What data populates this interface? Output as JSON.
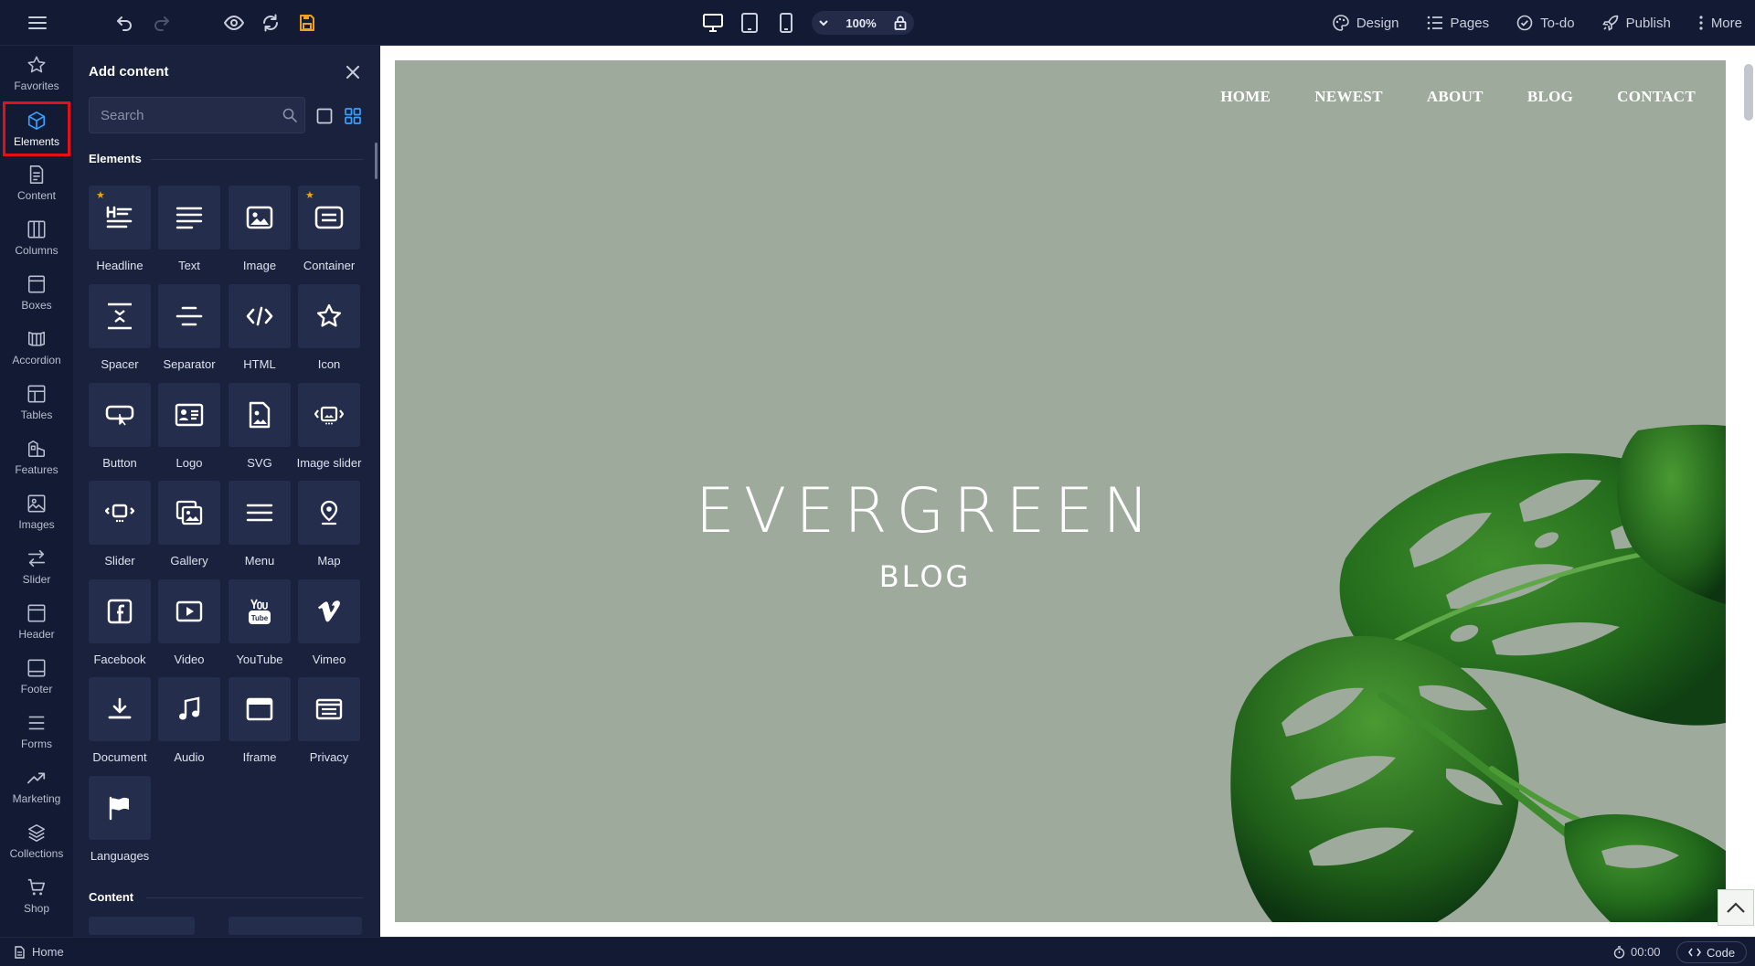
{
  "toolbar": {
    "zoom": "100%",
    "links": [
      {
        "label": "Design",
        "icon": "palette-icon"
      },
      {
        "label": "Pages",
        "icon": "list-icon"
      },
      {
        "label": "To-do",
        "icon": "check-circle-icon"
      },
      {
        "label": "Publish",
        "icon": "rocket-icon"
      },
      {
        "label": "More",
        "icon": "kebab-icon"
      }
    ]
  },
  "rail": {
    "active": "Elements",
    "items": [
      {
        "label": "Favorites",
        "icon": "star-icon"
      },
      {
        "label": "Elements",
        "icon": "cube-icon"
      },
      {
        "label": "Content",
        "icon": "document-icon"
      },
      {
        "label": "Columns",
        "icon": "columns-icon"
      },
      {
        "label": "Boxes",
        "icon": "box-icon"
      },
      {
        "label": "Accordion",
        "icon": "accordion-icon"
      },
      {
        "label": "Tables",
        "icon": "table-icon"
      },
      {
        "label": "Features",
        "icon": "features-icon"
      },
      {
        "label": "Images",
        "icon": "image-icon"
      },
      {
        "label": "Slider",
        "icon": "slider-icon"
      },
      {
        "label": "Header",
        "icon": "header-icon"
      },
      {
        "label": "Footer",
        "icon": "footer-icon"
      },
      {
        "label": "Forms",
        "icon": "forms-icon"
      },
      {
        "label": "Marketing",
        "icon": "trend-icon"
      },
      {
        "label": "Collections",
        "icon": "layers-icon"
      },
      {
        "label": "Shop",
        "icon": "cart-icon"
      }
    ]
  },
  "panel": {
    "title": "Add content",
    "search_placeholder": "Search",
    "sections": {
      "elements": "Elements",
      "content": "Content"
    },
    "elements": [
      {
        "label": "Headline",
        "icon": "headline-icon",
        "favorite": true
      },
      {
        "label": "Text",
        "icon": "text-icon",
        "favorite": false
      },
      {
        "label": "Image",
        "icon": "image-icon",
        "favorite": false
      },
      {
        "label": "Container",
        "icon": "container-icon",
        "favorite": true
      },
      {
        "label": "Spacer",
        "icon": "spacer-icon",
        "favorite": false
      },
      {
        "label": "Separator",
        "icon": "separator-icon",
        "favorite": false
      },
      {
        "label": "HTML",
        "icon": "code-icon",
        "favorite": false
      },
      {
        "label": "Icon",
        "icon": "star-icon",
        "favorite": false
      },
      {
        "label": "Button",
        "icon": "button-icon",
        "favorite": false
      },
      {
        "label": "Logo",
        "icon": "logo-icon",
        "favorite": false
      },
      {
        "label": "SVG",
        "icon": "svg-file-icon",
        "favorite": false
      },
      {
        "label": "Image slider",
        "icon": "image-slider-icon",
        "favorite": false
      },
      {
        "label": "Slider",
        "icon": "slider-element-icon",
        "favorite": false
      },
      {
        "label": "Gallery",
        "icon": "gallery-icon",
        "favorite": false
      },
      {
        "label": "Menu",
        "icon": "menu-icon",
        "favorite": false
      },
      {
        "label": "Map",
        "icon": "map-pin-icon",
        "favorite": false
      },
      {
        "label": "Facebook",
        "icon": "facebook-icon",
        "favorite": false
      },
      {
        "label": "Video",
        "icon": "video-icon",
        "favorite": false
      },
      {
        "label": "YouTube",
        "icon": "youtube-icon",
        "favorite": false
      },
      {
        "label": "Vimeo",
        "icon": "vimeo-icon",
        "favorite": false
      },
      {
        "label": "Document",
        "icon": "download-icon",
        "favorite": false
      },
      {
        "label": "Audio",
        "icon": "music-note-icon",
        "favorite": false
      },
      {
        "label": "Iframe",
        "icon": "iframe-icon",
        "favorite": false
      },
      {
        "label": "Privacy",
        "icon": "privacy-icon",
        "favorite": false
      },
      {
        "label": "Languages",
        "icon": "flag-icon",
        "favorite": false
      }
    ]
  },
  "site": {
    "nav": [
      "HOME",
      "NEWEST",
      "ABOUT",
      "BLOG",
      "CONTACT"
    ],
    "title": "EVERGREEN",
    "subtitle": "BLOG"
  },
  "statusbar": {
    "page": "Home",
    "timer": "00:00",
    "code_label": "Code"
  },
  "colors": {
    "accent": "#3aa0ff",
    "active_outline": "#e3101b",
    "favorite_star": "#f0a11b",
    "hero_bg": "#9daa9c"
  }
}
